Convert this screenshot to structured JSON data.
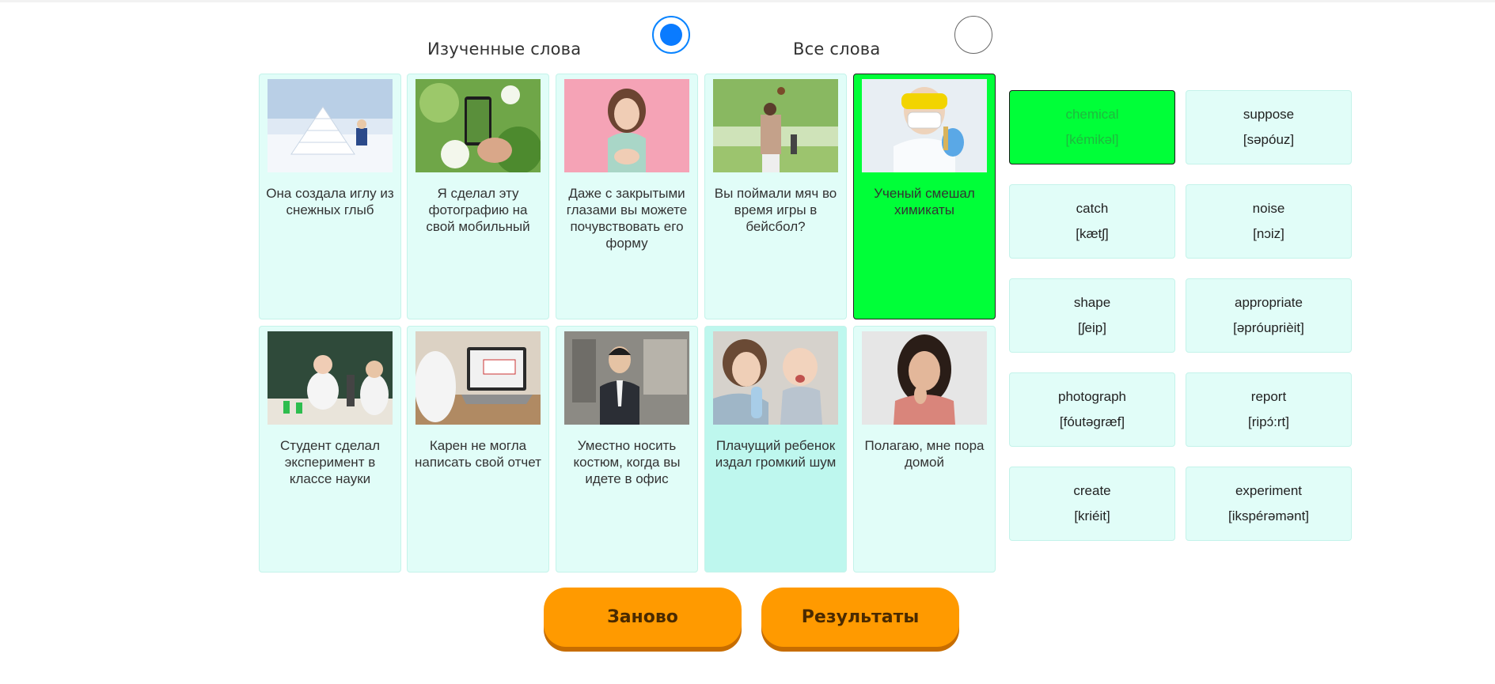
{
  "header": {
    "learned_label": "Изученные слова",
    "all_label": "Все слова",
    "selected_mode": "learned"
  },
  "sentences": [
    {
      "text": "Она создала иглу из снежных глыб",
      "image": "igloo-photo",
      "state": "normal"
    },
    {
      "text": "Я сделал эту фотографию на свой мобильный",
      "image": "phone-photo",
      "state": "normal"
    },
    {
      "text": "Даже с закрытыми глазами вы можете почувствовать его форму",
      "image": "woman-eyes-closed-photo",
      "state": "normal"
    },
    {
      "text": "Вы поймали мяч во время игры в бейсбол?",
      "image": "baseball-catch-photo",
      "state": "normal"
    },
    {
      "text": "Ученый смешал химикаты",
      "image": "scientist-photo",
      "state": "matched"
    },
    {
      "text": "Студент сделал эксперимент в классе науки",
      "image": "science-class-photo",
      "state": "normal"
    },
    {
      "text": "Карен не могла написать свой отчет",
      "image": "laptop-photo",
      "state": "normal"
    },
    {
      "text": "Уместно носить костюм, когда вы идете в офис",
      "image": "man-in-suit-photo",
      "state": "normal"
    },
    {
      "text": "Плачущий ребенок издал громкий шум",
      "image": "crying-baby-photo",
      "state": "hover"
    },
    {
      "text": "Полагаю, мне пора домой",
      "image": "thinking-woman-photo",
      "state": "normal"
    }
  ],
  "words": [
    {
      "word": "chemical",
      "transcription": "[kémikəl]",
      "state": "matched"
    },
    {
      "word": "suppose",
      "transcription": "[səpóuz]",
      "state": "normal"
    },
    {
      "word": "catch",
      "transcription": "[kætʃ]",
      "state": "normal"
    },
    {
      "word": "noise",
      "transcription": "[nɔiz]",
      "state": "normal"
    },
    {
      "word": "shape",
      "transcription": "[ʃeip]",
      "state": "normal"
    },
    {
      "word": "appropriate",
      "transcription": "[əpróuprièit]",
      "state": "normal"
    },
    {
      "word": "photograph",
      "transcription": "[fóutəgræf]",
      "state": "normal"
    },
    {
      "word": "report",
      "transcription": "[ripɔ́:rt]",
      "state": "normal"
    },
    {
      "word": "create",
      "transcription": "[kriéit]",
      "state": "normal"
    },
    {
      "word": "experiment",
      "transcription": "[ikspérəmənt]",
      "state": "normal"
    }
  ],
  "buttons": {
    "restart_label": "Заново",
    "results_label": "Результаты"
  },
  "colors": {
    "card_bg": "#e1fdf8",
    "matched_bg": "#00ff38",
    "button_bg": "#ff9a00",
    "radio_active": "#0a7bff"
  }
}
